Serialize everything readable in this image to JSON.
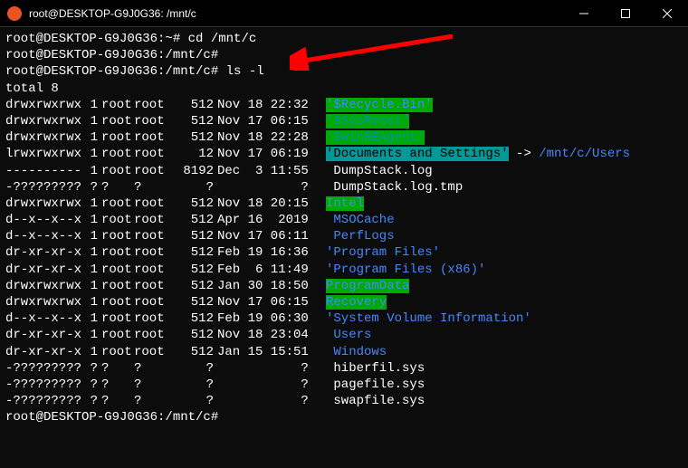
{
  "window": {
    "title": "root@DESKTOP-G9J0G36: /mnt/c"
  },
  "prompts": {
    "p1": "root@DESKTOP-G9J0G36:~#",
    "p2": "root@DESKTOP-G9J0G36:/mnt/c#",
    "p3": "root@DESKTOP-G9J0G36:/mnt/c#",
    "p4": "root@DESKTOP-G9J0G36:/mnt/c#"
  },
  "commands": {
    "cmd1": " cd /mnt/c",
    "cmd2": "",
    "cmd3": " ls -l"
  },
  "total": "total 8",
  "files": [
    {
      "perms": "drwxrwxrwx",
      "links": "1",
      "owner": "root",
      "group": "root",
      "size": "512",
      "date": "Nov 18 22:32",
      "name": "'$Recycle.Bin'",
      "style": "green-bg"
    },
    {
      "perms": "drwxrwxrwx",
      "links": "1",
      "owner": "root",
      "group": "root",
      "size": "512",
      "date": "Nov 17 06:15",
      "name": "'$SysReset'",
      "style": "green-bg-teal"
    },
    {
      "perms": "drwxrwxrwx",
      "links": "1",
      "owner": "root",
      "group": "root",
      "size": "512",
      "date": "Nov 18 22:28",
      "name": "'$WinREAgent'",
      "style": "green-bg-teal"
    },
    {
      "perms": "lrwxrwxrwx",
      "links": "1",
      "owner": "root",
      "group": "root",
      "size": "12",
      "date": "Nov 17 06:19",
      "name": "'Documents and Settings'",
      "style": "cyan-bg",
      "suffix": " -> ",
      "target": "/mnt/c/Users"
    },
    {
      "perms": "----------",
      "links": "1",
      "owner": "root",
      "group": "root",
      "size": "8192",
      "date": "Dec  3 11:55",
      "name": " DumpStack.log",
      "style": "white"
    },
    {
      "perms": "-?????????",
      "links": "?",
      "owner": "?",
      "group": "?",
      "size": "?",
      "date": "           ?",
      "name": " DumpStack.log.tmp",
      "style": "white"
    },
    {
      "perms": "drwxrwxrwx",
      "links": "1",
      "owner": "root",
      "group": "root",
      "size": "512",
      "date": "Nov 18 20:15",
      "name": "Intel",
      "style": "green-bg"
    },
    {
      "perms": "d--x--x--x",
      "links": "1",
      "owner": "root",
      "group": "root",
      "size": "512",
      "date": "Apr 16  2019",
      "name": " MSOCache",
      "style": "blue"
    },
    {
      "perms": "d--x--x--x",
      "links": "1",
      "owner": "root",
      "group": "root",
      "size": "512",
      "date": "Nov 17 06:11",
      "name": " PerfLogs",
      "style": "blue"
    },
    {
      "perms": "dr-xr-xr-x",
      "links": "1",
      "owner": "root",
      "group": "root",
      "size": "512",
      "date": "Feb 19 16:36",
      "name": "'Program Files'",
      "style": "blue"
    },
    {
      "perms": "dr-xr-xr-x",
      "links": "1",
      "owner": "root",
      "group": "root",
      "size": "512",
      "date": "Feb  6 11:49",
      "name": "'Program Files (x86)'",
      "style": "blue"
    },
    {
      "perms": "drwxrwxrwx",
      "links": "1",
      "owner": "root",
      "group": "root",
      "size": "512",
      "date": "Jan 30 18:50",
      "name": "ProgramData",
      "style": "green-bg"
    },
    {
      "perms": "drwxrwxrwx",
      "links": "1",
      "owner": "root",
      "group": "root",
      "size": "512",
      "date": "Nov 17 06:15",
      "name": "Recovery",
      "style": "green-bg"
    },
    {
      "perms": "d--x--x--x",
      "links": "1",
      "owner": "root",
      "group": "root",
      "size": "512",
      "date": "Feb 19 06:30",
      "name": "'System Volume Information'",
      "style": "blue"
    },
    {
      "perms": "dr-xr-xr-x",
      "links": "1",
      "owner": "root",
      "group": "root",
      "size": "512",
      "date": "Nov 18 23:04",
      "name": " Users",
      "style": "blue"
    },
    {
      "perms": "dr-xr-xr-x",
      "links": "1",
      "owner": "root",
      "group": "root",
      "size": "512",
      "date": "Jan 15 15:51",
      "name": " Windows",
      "style": "blue"
    },
    {
      "perms": "-?????????",
      "links": "?",
      "owner": "?",
      "group": "?",
      "size": "?",
      "date": "           ?",
      "name": " hiberfil.sys",
      "style": "white"
    },
    {
      "perms": "-?????????",
      "links": "?",
      "owner": "?",
      "group": "?",
      "size": "?",
      "date": "           ?",
      "name": " pagefile.sys",
      "style": "white"
    },
    {
      "perms": "-?????????",
      "links": "?",
      "owner": "?",
      "group": "?",
      "size": "?",
      "date": "           ?",
      "name": " swapfile.sys",
      "style": "white"
    }
  ]
}
